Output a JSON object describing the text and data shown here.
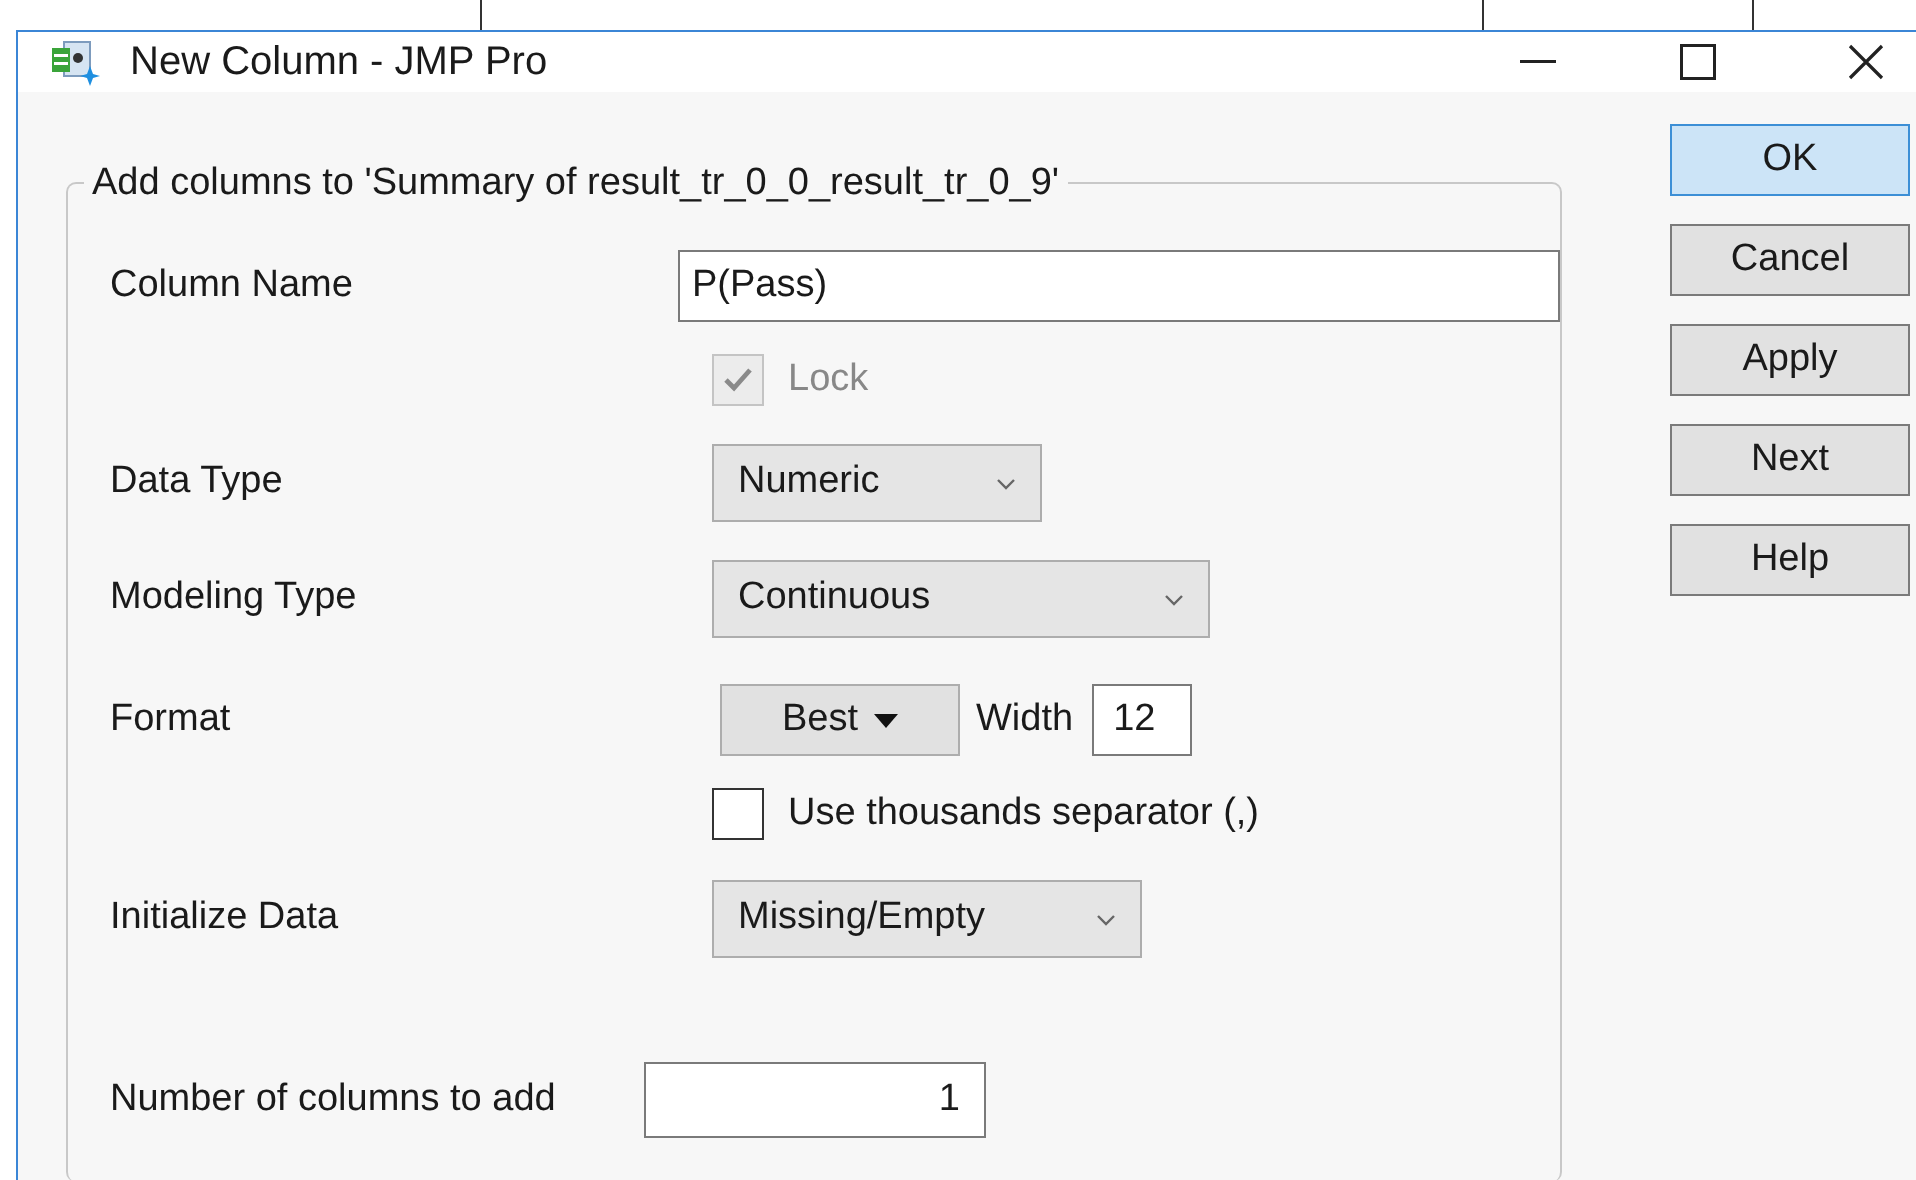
{
  "window": {
    "title": "New Column - JMP Pro"
  },
  "group": {
    "title": "Add columns to 'Summary of result_tr_0_0_result_tr_0_9'"
  },
  "rows": [
    {
      "kind": "text",
      "label": "Column Name",
      "value": "P(Pass)"
    },
    {
      "kind": "checkbox",
      "text": "Lock",
      "checked": true,
      "disabled": true
    },
    {
      "kind": "dropdown",
      "label": "Data Type",
      "value": "Numeric"
    },
    {
      "kind": "dropdown",
      "label": "Modeling Type",
      "value": "Continuous"
    },
    {
      "kind": "format",
      "label": "Format",
      "button": "Best",
      "width_label": "Width",
      "width_value": "12"
    },
    {
      "kind": "checkbox",
      "text": "Use thousands separator (,)",
      "checked": false,
      "disabled": false
    },
    {
      "kind": "dropdown",
      "label": "Initialize Data",
      "value": "Missing/Empty"
    },
    {
      "kind": "number",
      "label": "Number of columns to add",
      "value": "1"
    }
  ],
  "buttons": [
    {
      "label": "OK",
      "default": true
    },
    {
      "label": "Cancel",
      "default": false
    },
    {
      "label": "Apply",
      "default": false
    },
    {
      "label": "Next",
      "default": false
    },
    {
      "label": "Help",
      "default": false
    }
  ]
}
